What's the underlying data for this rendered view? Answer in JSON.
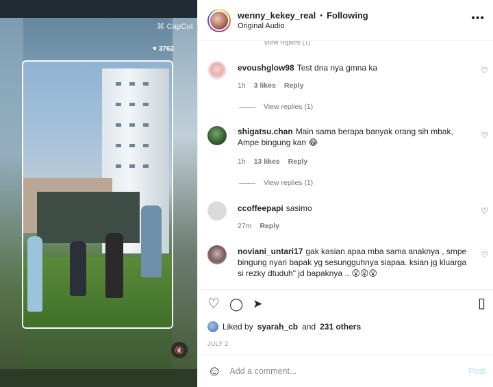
{
  "media": {
    "watermark": "CapCut",
    "like_count": "3762",
    "icons": {
      "heart": "heart-icon",
      "mute": "speaker-muted-icon"
    }
  },
  "header": {
    "username": "wenny_kekey_real",
    "separator": "•",
    "follow_status": "Following",
    "audio": "Original Audio",
    "more_icon": "•••"
  },
  "comments": {
    "cutoff_view_replies": "View replies (1)",
    "items": [
      {
        "user": "evoushglow98",
        "text": "Test dna nya gmna ka",
        "time": "1h",
        "likes": "3 likes",
        "reply": "Reply",
        "view_replies": "View replies (1)"
      },
      {
        "user": "shigatsu.chan",
        "text": "Main sama berapa banyak orang sih mbak, Ampe bingung kan 😂",
        "time": "1h",
        "likes": "13 likes",
        "reply": "Reply",
        "view_replies": "View replies (1)"
      },
      {
        "user": "ccoffeepapi",
        "text": "sasimo",
        "time": "27m",
        "likes": "",
        "reply": "Reply",
        "view_replies": ""
      },
      {
        "user": "noviani_untari17",
        "text": "gak kasian apaa mba sama anaknya , smpe bingung nyari bapak yg sesungguhnya siapaa. ksian jg kluarga si rezky dtuduh\" jd bapaknya .. 😮😮😮",
        "time": "",
        "likes": "",
        "reply": "",
        "view_replies": ""
      }
    ]
  },
  "actions": {
    "like_icon": "♡",
    "comment_icon": "◯",
    "share_icon": "➤",
    "bookmark_icon": "▯",
    "liked_by_prefix": "Liked by",
    "liked_by_user": "syarah_cb",
    "liked_by_and": "and",
    "liked_by_others": "231 others",
    "date": "JULY 2"
  },
  "add_comment": {
    "emoji_icon": "☺",
    "placeholder": "Add a comment...",
    "post_label": "Post"
  },
  "colors": {
    "link": "#0095f6",
    "post_disabled": "#b2dffc",
    "muted_text": "#737373"
  }
}
